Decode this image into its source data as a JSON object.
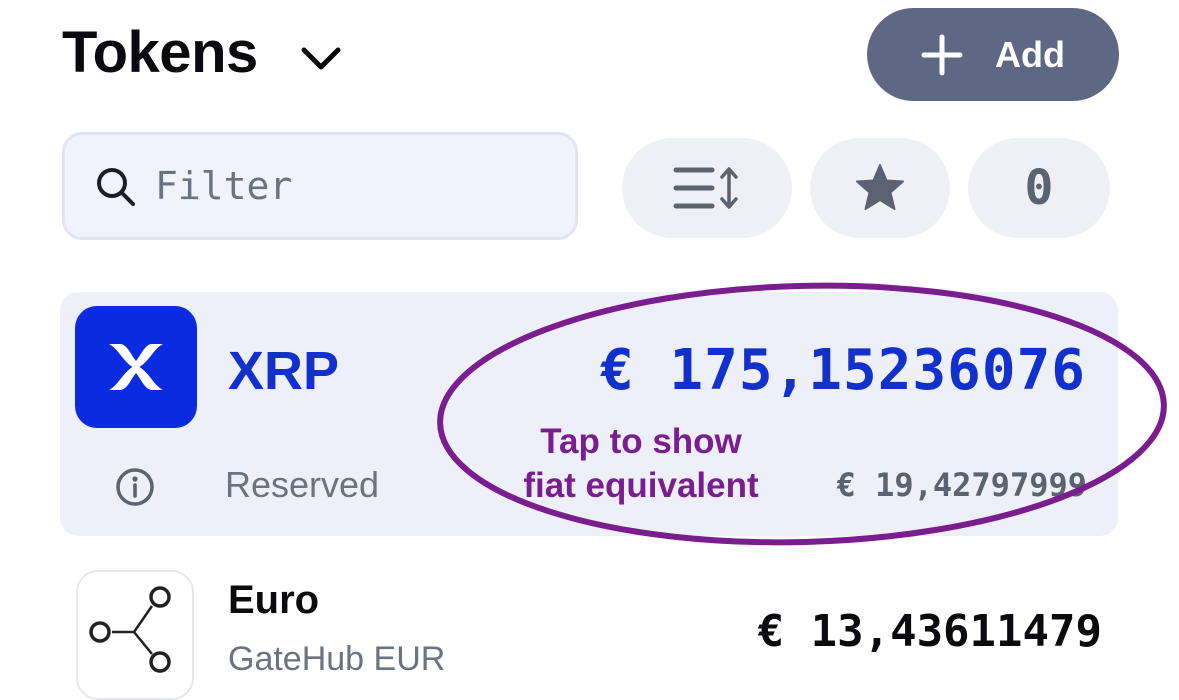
{
  "header": {
    "title": "Tokens",
    "add_label": "Add"
  },
  "filter": {
    "placeholder": "Filter",
    "value": ""
  },
  "chips": {
    "count": "0"
  },
  "tokens": [
    {
      "name": "XRP",
      "amount": "€ 175,15236076",
      "reserved_label": "Reserved",
      "fiat": "€ 19,42797999",
      "icon": "xrp-logo",
      "logo_color": "#0a2be0"
    },
    {
      "name": "Euro",
      "subtitle": "GateHub EUR",
      "amount": "€ 13,43611479",
      "icon": "gatehub-logo"
    }
  ],
  "annotation": {
    "line1": "Tap to show",
    "line2": "fiat equivalent",
    "color": "#7a1d8e"
  },
  "colors": {
    "accent": "#1230cc",
    "add_button": "#5e6885",
    "card_bg": "#eef0f9"
  }
}
